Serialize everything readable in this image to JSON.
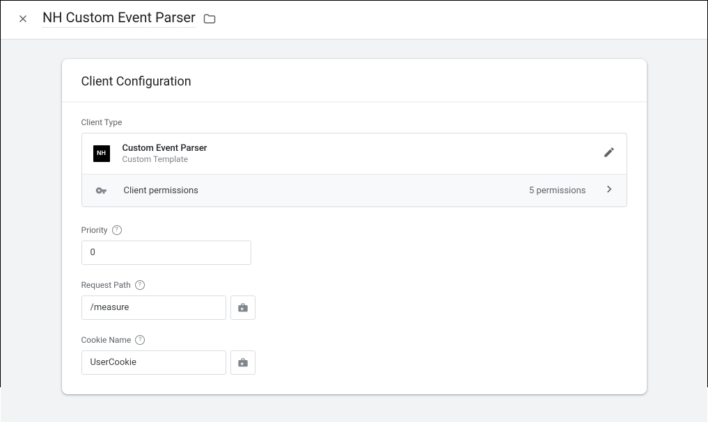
{
  "header": {
    "title": "NH Custom Event Parser"
  },
  "card": {
    "title": "Client Configuration",
    "clientType": {
      "label": "Client Type",
      "badge": "NH",
      "name": "Custom Event Parser",
      "sub": "Custom Template",
      "permissionsLabel": "Client permissions",
      "permissionsCount": "5 permissions"
    },
    "fields": {
      "priority": {
        "label": "Priority",
        "value": "0"
      },
      "requestPath": {
        "label": "Request Path",
        "value": "/measure"
      },
      "cookieName": {
        "label": "Cookie Name",
        "value": "UserCookie"
      }
    }
  }
}
